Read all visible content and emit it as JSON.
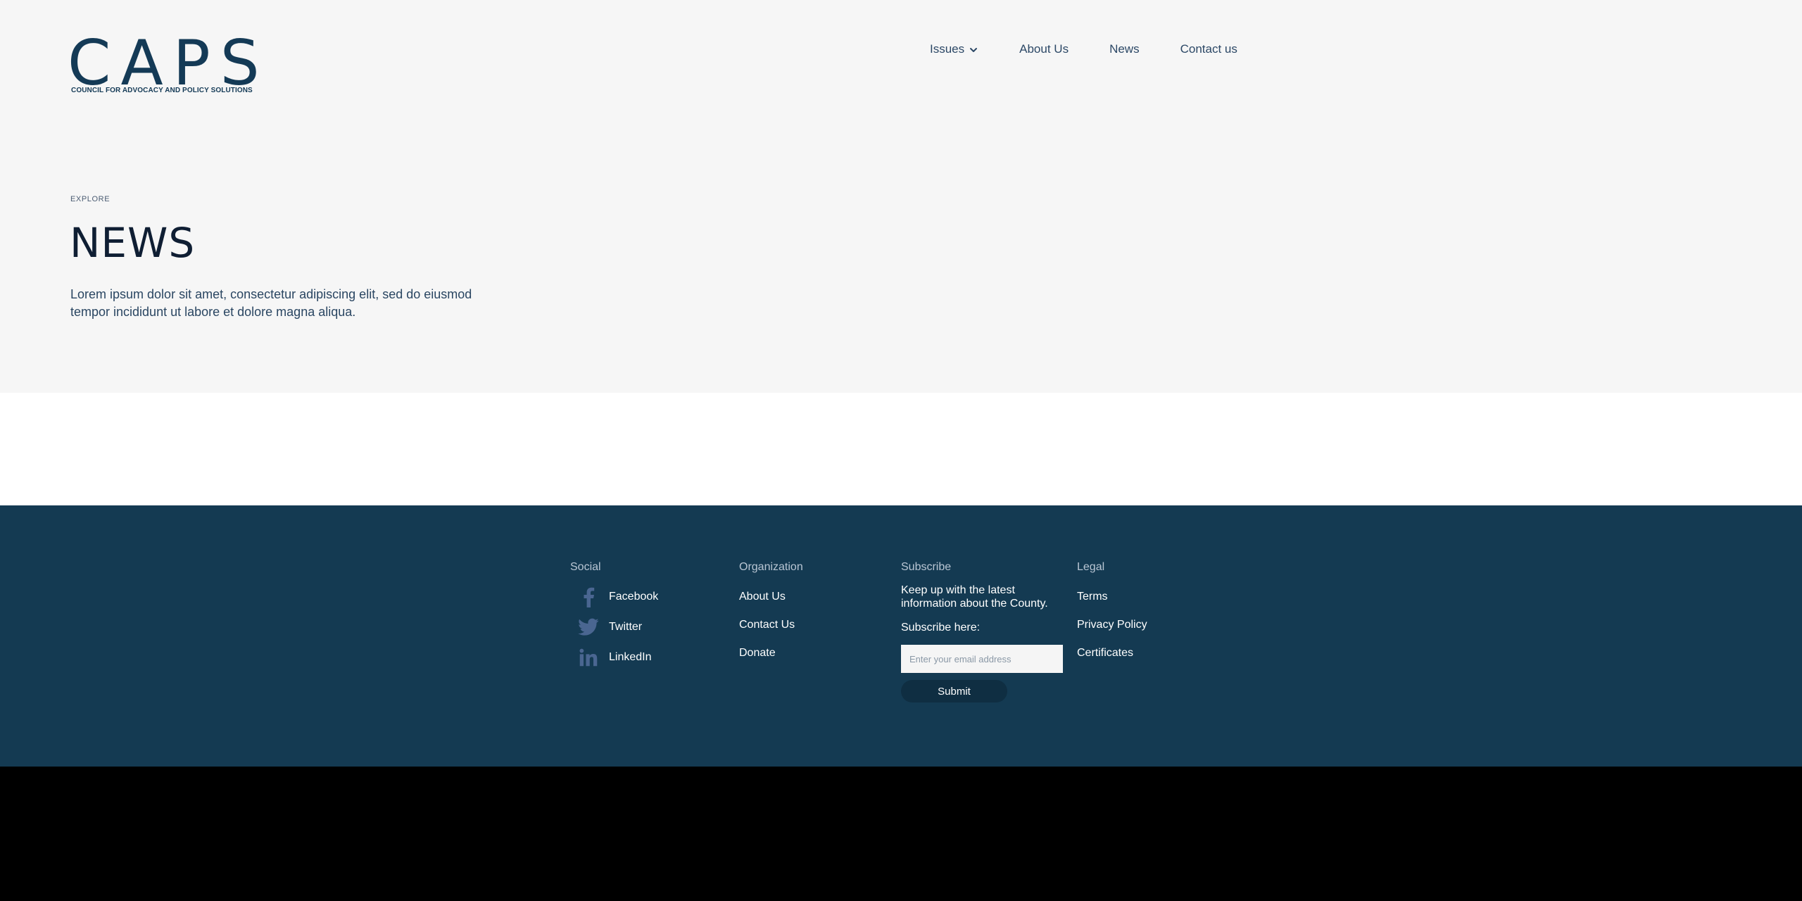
{
  "brand": {
    "logo_text": "CAPS",
    "tagline": "COUNCIL FOR ADVOCACY AND POLICY SOLUTIONS",
    "primary_color": "#143a56"
  },
  "nav": {
    "items": [
      {
        "label": "Issues",
        "has_dropdown": true
      },
      {
        "label": "About Us"
      },
      {
        "label": "News"
      },
      {
        "label": "Contact us"
      }
    ]
  },
  "hero": {
    "eyebrow": "EXPLORE",
    "title": "NEWS",
    "intro": "Lorem ipsum dolor sit amet, consectetur adipiscing elit, sed do eiusmod tempor incididunt ut labore et dolore magna aliqua."
  },
  "footer": {
    "background": "#143a52",
    "social": {
      "heading": "Social",
      "items": [
        {
          "label": "Facebook",
          "icon": "facebook-icon"
        },
        {
          "label": "Twitter",
          "icon": "twitter-icon"
        },
        {
          "label": "LinkedIn",
          "icon": "linkedin-icon"
        }
      ]
    },
    "organization": {
      "heading": "Organization",
      "links": [
        "About Us",
        "Contact Us",
        "Donate"
      ]
    },
    "subscribe": {
      "heading": "Subscribe",
      "text": "Keep up with the latest information about the County.",
      "label": "Subscribe here:",
      "placeholder": "Enter your email address",
      "button": "Submit"
    },
    "legal": {
      "heading": "Legal",
      "links": [
        "Terms",
        "Privacy Policy",
        "Certificates"
      ]
    }
  }
}
